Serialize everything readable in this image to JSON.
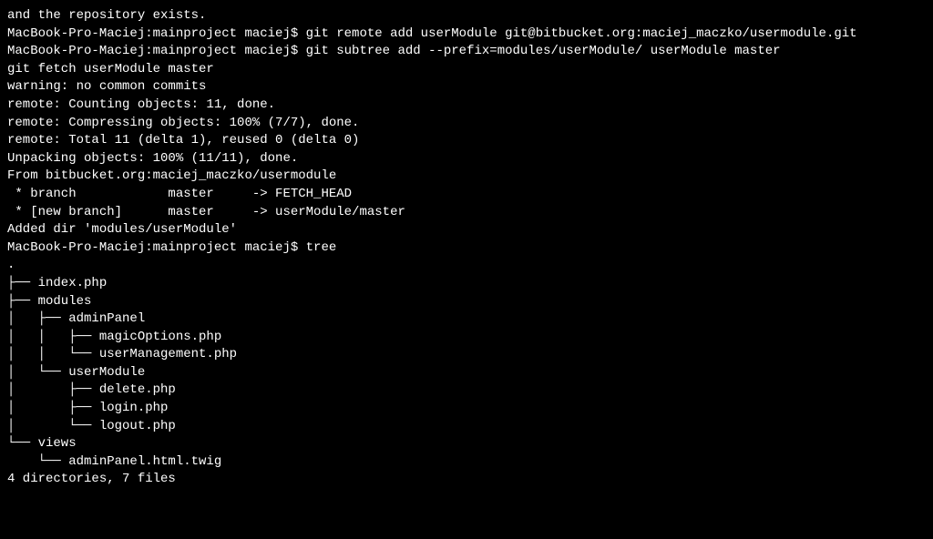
{
  "lines": [
    "and the repository exists.",
    "MacBook-Pro-Maciej:mainproject maciej$ git remote add userModule git@bitbucket.org:maciej_maczko/usermodule.git",
    "MacBook-Pro-Maciej:mainproject maciej$ git subtree add --prefix=modules/userModule/ userModule master",
    "git fetch userModule master",
    "warning: no common commits",
    "remote: Counting objects: 11, done.",
    "remote: Compressing objects: 100% (7/7), done.",
    "remote: Total 11 (delta 1), reused 0 (delta 0)",
    "Unpacking objects: 100% (11/11), done.",
    "From bitbucket.org:maciej_maczko/usermodule",
    " * branch            master     -> FETCH_HEAD",
    " * [new branch]      master     -> userModule/master",
    "Added dir 'modules/userModule'",
    "MacBook-Pro-Maciej:mainproject maciej$ tree",
    ".",
    "├── index.php",
    "├── modules",
    "│   ├── adminPanel",
    "│   │   ├── magicOptions.php",
    "│   │   └── userManagement.php",
    "│   └── userModule",
    "│       ├── delete.php",
    "│       ├── login.php",
    "│       └── logout.php",
    "└── views",
    "    └── adminPanel.html.twig",
    "",
    "4 directories, 7 files"
  ]
}
